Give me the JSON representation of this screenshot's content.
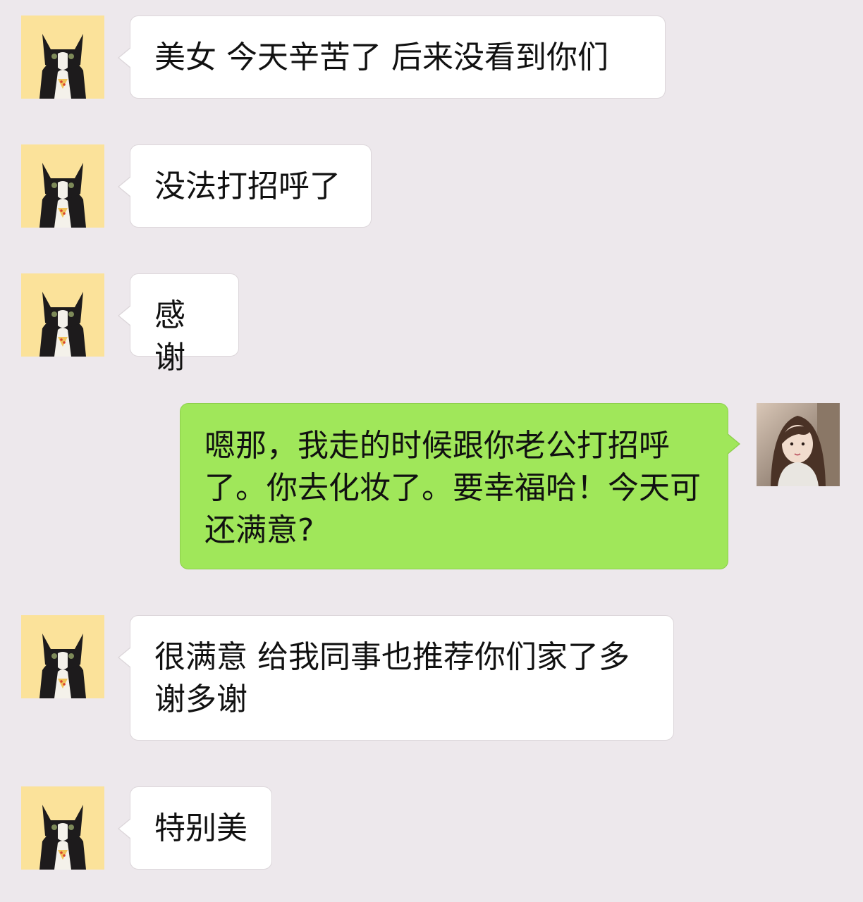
{
  "chat": {
    "background_color": "#ede8ec",
    "incoming_bubble_color": "#ffffff",
    "outgoing_bubble_color": "#a0e75a",
    "contact_avatar": "cat-avatar-icon",
    "self_avatar": "user-photo-avatar",
    "messages": [
      {
        "sender": "contact",
        "text": "美女 今天辛苦了 后来没看到你们"
      },
      {
        "sender": "contact",
        "text": "没法打招呼了"
      },
      {
        "sender": "contact",
        "text": "感谢"
      },
      {
        "sender": "self",
        "text": "嗯那，我走的时候跟你老公打招呼了。你去化妆了。要幸福哈！今天可还满意?"
      },
      {
        "sender": "contact",
        "text": "很满意 给我同事也推荐你们家了多谢多谢"
      },
      {
        "sender": "contact",
        "text": "特别美"
      }
    ]
  }
}
